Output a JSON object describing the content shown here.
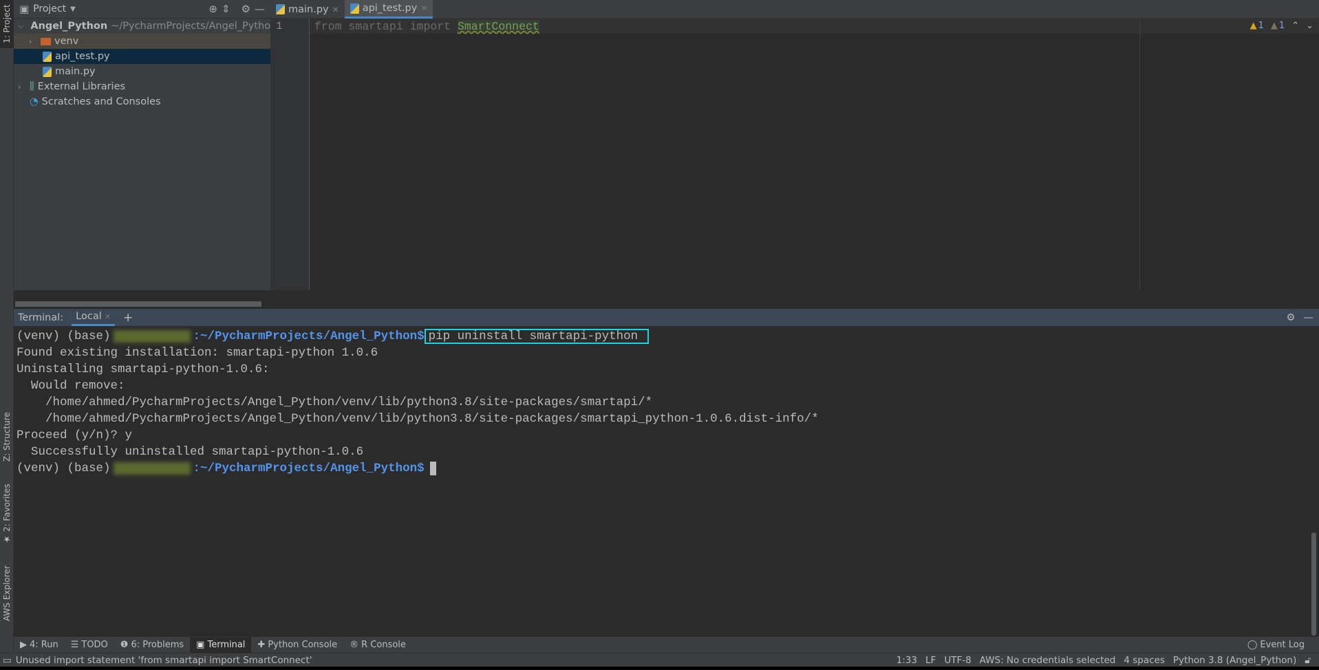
{
  "left_strip": {
    "project": "1: Project",
    "structure": "Z: Structure",
    "favorites": "2: Favorites",
    "aws": "AWS Explorer"
  },
  "project_panel": {
    "title": "Project",
    "tree": [
      {
        "label": "Angel_Python",
        "hint": "~/PycharmProjects/Angel_Pytho"
      },
      {
        "label": "venv"
      },
      {
        "label": "api_test.py"
      },
      {
        "label": "main.py"
      },
      {
        "label": "External Libraries"
      },
      {
        "label": "Scratches and Consoles"
      }
    ]
  },
  "editor": {
    "tabs": [
      {
        "label": "main.py"
      },
      {
        "label": "api_test.py"
      }
    ],
    "line_number": "1",
    "code": {
      "kw1": "from",
      "mod": " smartapi ",
      "kw2": "import",
      "cls": "SmartConnect"
    },
    "warnings": "1",
    "weak_warnings": "1"
  },
  "terminal": {
    "label": "Terminal:",
    "tab": "Local",
    "add": "+",
    "prompt_prefix": "(venv) (base)",
    "prompt_path": ":~/PycharmProjects/Angel_Python$",
    "command": "pip uninstall smartapi-python",
    "output": [
      "Found existing installation: smartapi-python 1.0.6",
      "Uninstalling smartapi-python-1.0.6:",
      "  Would remove:",
      "    /home/ahmed/PycharmProjects/Angel_Python/venv/lib/python3.8/site-packages/smartapi/*",
      "    /home/ahmed/PycharmProjects/Angel_Python/venv/lib/python3.8/site-packages/smartapi_python-1.0.6.dist-info/*",
      "Proceed (y/n)? y",
      "  Successfully uninstalled smartapi-python-1.0.6"
    ]
  },
  "tool_windows": [
    "4: Run",
    "TODO",
    "6: Problems",
    "Terminal",
    "Python Console",
    "R Console"
  ],
  "event_log": "Event Log",
  "status": {
    "message": "Unused import statement 'from smartapi import SmartConnect'",
    "position": "1:33",
    "line_sep": "LF",
    "encoding": "UTF-8",
    "aws": "AWS: No credentials selected",
    "indent": "4 spaces",
    "interpreter": "Python 3.8 (Angel_Python)"
  },
  "colors": {
    "accent": "#4a88c7",
    "path": "#5394ec",
    "highlight_box": "#19d6e6"
  }
}
